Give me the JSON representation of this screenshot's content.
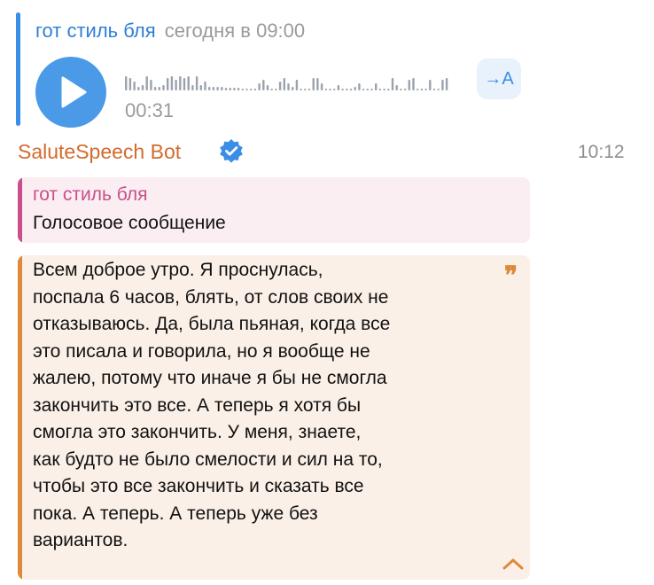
{
  "forwarded": {
    "author": "гот стиль бля",
    "date": "сегодня в 09:00",
    "duration": "00:31",
    "transcribe_label": "→A",
    "accent_color": "#3a8ee6"
  },
  "bot": {
    "name": "SaluteSpeech Bot",
    "time": "10:12",
    "name_color": "#d26b2d"
  },
  "reply": {
    "author": "гот стиль бля",
    "text": "Голосовое сообщение",
    "color": "#c94f8a"
  },
  "quote": {
    "text": "Всем доброе утро. Я проснулась,\nпоспала 6 часов, блять, от слов своих не\nотказываюсь. Да, была пьяная, когда все\nэто писала и говорила, но я вообще не\nжалею, потому что иначе я бы не смогла\nзакончить это все. А теперь я хотя бы\nсмогла это закончить. У меня, знаете,\nкак будто не было смелости и сил на то,\nчтобы это все закончить и сказать все\nпока. А теперь. А теперь уже без\nвариантов.",
    "quote_mark": "❞",
    "color": "#de8a3a"
  },
  "icons": {
    "play": "play-icon",
    "verified": "verified-badge-icon",
    "collapse": "chevron-up-icon"
  }
}
